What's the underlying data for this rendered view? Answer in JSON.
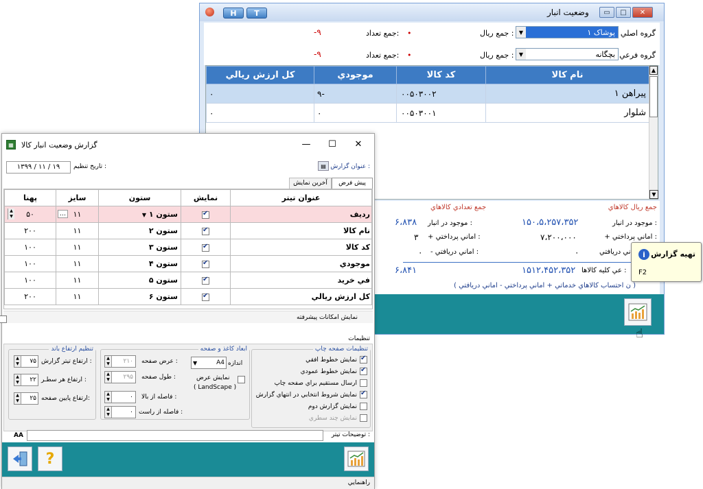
{
  "inv": {
    "title": "وضعيت انبار",
    "h_btn": "H",
    "t_btn": "T",
    "main_group_label": "گروه اصلي",
    "main_group_value": "پوشاک ۱",
    "sub_group_label": "گروه فرعي",
    "sub_group_value": "بچگانه",
    "rial_label": "جمع ريال :",
    "count_label": "جمع تعداد:",
    "count_value": "-۹",
    "columns": [
      "نام کالا",
      "کد کالا",
      "موجودي",
      "کل ارزش ريالي"
    ],
    "rows": [
      {
        "name": "پيراهن ۱",
        "code": "۰۰۵۰۳۰۰۲",
        "qty": "-۹",
        "value": "۰"
      },
      {
        "name": "شلوار",
        "code": "۰۰۵۰۳۰۰۱",
        "qty": "۰",
        "value": "۰"
      }
    ],
    "sum_rial_title": "جمع ريال کالاهاي",
    "sum_count_title": "جمع تعدادي کالاهاي",
    "stock_label": "موجود در انبار :",
    "stock_rial": "۱۵۰،۵،۲۵۷،۳۵۲",
    "stock_count": "۶،۸۳۸",
    "paid_label": "+ اماني پرداختي :",
    "paid_rial": "۷،۲۰۰،۰۰۰",
    "paid_count": "۳",
    "recv_label": "اني دريافتي :",
    "recv_label_count": "- اماني دريافتي :",
    "recv_rial": "۰",
    "recv_count": "۰",
    "total_label": "عي کليه کالاها :",
    "total_rial": "۱۵۱۲،۴۵۲،۳۵۲",
    "total_count": "۶،۸۴۱",
    "note": "( ن احتساب کالاهاي خدماتي + اماني پرداختي - اماني دريافتي )"
  },
  "tooltip": {
    "title": "تهيه گزارش",
    "shortcut": "F2"
  },
  "rep": {
    "title": "گزارش وضعيت انبار کالا",
    "date_label": "تاريخ تنظيم :",
    "date_value": "۱۳۹۹ / ۱۱ / ۱۹",
    "report_title_label": "عنوان گزارش :",
    "tab_default": "پيش فرض",
    "tab_last": "آخرين نمايش",
    "columns": [
      "عنوان تيتر",
      "نمايش",
      "ستون",
      "سايز",
      "پهنا"
    ],
    "rows": [
      {
        "title": "رديف",
        "show": true,
        "col": "ستون ۱",
        "size": "۱۱",
        "width": "۵۰"
      },
      {
        "title": "نام کالا",
        "show": true,
        "col": "ستون ۲",
        "size": "۱۱",
        "width": "۲۰۰"
      },
      {
        "title": "کد کالا",
        "show": true,
        "col": "ستون ۳",
        "size": "۱۱",
        "width": "۱۰۰"
      },
      {
        "title": "موجودي",
        "show": true,
        "col": "ستون ۴",
        "size": "۱۱",
        "width": "۱۰۰"
      },
      {
        "title": "في خريد",
        "show": true,
        "col": "ستون ۵",
        "size": "۱۱",
        "width": "۱۰۰"
      },
      {
        "title": "کل ارزش ريالي",
        "show": true,
        "col": "ستون ۶",
        "size": "۱۱",
        "width": "۲۰۰"
      }
    ],
    "advanced_label": "نمايش امکانات پيشرفته",
    "settings_tab": "تنظيمات",
    "print_legend": "تنظيمات صفحه چاپ",
    "print_options": [
      {
        "label": "نمايش خطوط افقي",
        "on": true
      },
      {
        "label": "نمايش خطوط عمودي",
        "on": true
      },
      {
        "label": "ارسال مستقيم براي صفحه چاپ",
        "on": false
      },
      {
        "label": "نمايش شروط انتخابي در انتهاي گزارش",
        "on": true
      },
      {
        "label": "نمايش گزارش دوم",
        "on": false
      },
      {
        "label": "نمايش چند سطري",
        "on": false
      }
    ],
    "paper_legend": "ابعاد کاغذ و صفحه",
    "size_label": "اندازه",
    "size_value": "A4",
    "landscape_label": "نمايش عرض",
    "landscape_sub": "( LandScape )",
    "page_width_label": "عرض صفحه :",
    "page_width": "۲۱۰",
    "page_height_label": "طول صفحه :",
    "page_height": "۲۹۵",
    "top_margin_label": "فاصله از بالا :",
    "top_margin": "۰",
    "right_margin_label": "فاصله از راست :",
    "right_margin": "۰",
    "height_legend": "تنظيم ارتفاع باند",
    "title_h_label": "ارتفاع تيتر گزارش :",
    "title_h": "۷۵",
    "row_h_label": "ارتفاع هر سطـر :",
    "row_h": "۲۲",
    "bottom_h_label": "ارتفاع پايين صفحه:",
    "bottom_h": "۲۵",
    "desc_label": "توضيحات تيتر :",
    "status": "راهنمايي"
  }
}
